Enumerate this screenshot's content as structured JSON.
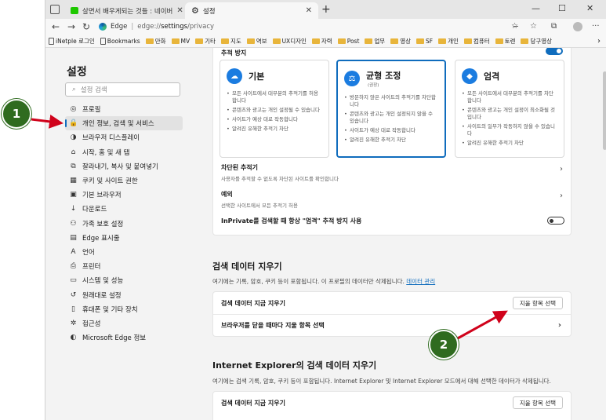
{
  "tabs": [
    {
      "title": "살면서 배우게되는 것들 : 네이버"
    },
    {
      "title": "설정"
    }
  ],
  "address": {
    "site": "Edge",
    "separator": "|",
    "scheme": "edge://",
    "host": "settings",
    "path": "/privacy"
  },
  "bookmarks": [
    "iNetple 로그인",
    "Bookmarks",
    "만화",
    "MV",
    "기타",
    "지도",
    "역보",
    "UX디자인",
    "자력",
    "Post",
    "업무",
    "영상",
    "SF",
    "개인",
    "컴퓨터",
    "토렌",
    "당구영상"
  ],
  "sidebar": {
    "title": "설정",
    "search_placeholder": "설정 검색",
    "items": [
      {
        "label": "프로필",
        "icon": "profile-icon",
        "glyph": "◎"
      },
      {
        "label": "개인 정보, 검색 및 서비스",
        "icon": "lock-icon",
        "glyph": "🔒",
        "active": true
      },
      {
        "label": "브라우저 디스플레이",
        "icon": "appearance-icon",
        "glyph": "◑"
      },
      {
        "label": "시작, 홈 및 새 탭",
        "icon": "home-icon",
        "glyph": "⌂"
      },
      {
        "label": "잘라내기, 복사 및 붙여넣기",
        "icon": "share-icon",
        "glyph": "⧉"
      },
      {
        "label": "쿠키 및 사이트 권한",
        "icon": "cookie-icon",
        "glyph": "▦"
      },
      {
        "label": "기본 브라우저",
        "icon": "browser-icon",
        "glyph": "▣"
      },
      {
        "label": "다운로드",
        "icon": "download-icon",
        "glyph": "↓"
      },
      {
        "label": "가족 보호 설정",
        "icon": "family-icon",
        "glyph": "⚇"
      },
      {
        "label": "Edge 표시줄",
        "icon": "bar-icon",
        "glyph": "▤"
      },
      {
        "label": "언어",
        "icon": "language-icon",
        "glyph": "A"
      },
      {
        "label": "프린터",
        "icon": "printer-icon",
        "glyph": "⎙"
      },
      {
        "label": "시스템 및 성능",
        "icon": "system-icon",
        "glyph": "▭"
      },
      {
        "label": "원래대로 설정",
        "icon": "reset-icon",
        "glyph": "↺"
      },
      {
        "label": "휴대폰 및 기타 장치",
        "icon": "phone-icon",
        "glyph": "▯"
      },
      {
        "label": "접근성",
        "icon": "accessibility-icon",
        "glyph": "✲"
      },
      {
        "label": "Microsoft Edge 정보",
        "icon": "edge-icon",
        "glyph": "◐"
      }
    ]
  },
  "tracking": {
    "title": "추적 방지",
    "options": [
      {
        "name": "기본",
        "recommended": "",
        "bullets": [
          "모든 사이트에서 대부분의 추적기를 허용합니다",
          "콘텐츠와 광고는 개인 설정될 수 있습니다",
          "사이트가 예상 대로 작동합니다",
          "알려진 유해한 추적기 차단"
        ]
      },
      {
        "name": "균형 조정",
        "recommended": "(권장)",
        "bullets": [
          "방문하지 않은 사이트의 추적기를 차단합니다",
          "콘텐츠와 광고는 개인 설정되지 않을 수 있습니다",
          "사이트가 예상 대로 작동합니다",
          "알려진 유해한 추적기 차단"
        ]
      },
      {
        "name": "엄격",
        "recommended": "",
        "bullets": [
          "모든 사이트에서 대부분의 추적기를 차단합니다",
          "콘텐츠와 광고는 개인 설정이 최소화될 것입니다",
          "사이트의 일부가 작동하지 않을 수 있습니다",
          "알려진 유해한 추적기 차단"
        ]
      }
    ],
    "blocked_title": "차단된 추적기",
    "blocked_sub": "사용자를 추적할 수 없도록 차단된 사이트를 확인합니다",
    "exceptions_title": "예외",
    "exceptions_sub": "선택한 사이트에서 모든 추적기 허용",
    "inprivate": "InPrivate를 검색할 때 항상 \"엄격\" 추적 방지 사용"
  },
  "clear_data": {
    "title": "검색 데이터 지우기",
    "desc": "여기에는 기록, 암호, 쿠키 등이 포함됩니다. 이 프로필의 데이터만 삭제됩니다.",
    "link": "데이터 관리",
    "now_label": "검색 데이터 지금 지우기",
    "button": "지울 항목 선택",
    "on_close": "브라우저를 닫을 때마다 지울 항목 선택"
  },
  "ie_clear": {
    "title": "Internet Explorer의 검색 데이터 지우기",
    "desc": "여기에는 검색 기록, 암호, 쿠키 등이 포함됩니다. Internet Explorer 및 Internet Explorer 모드에서 대해 선택한 데이터가 삭제됩니다.",
    "now_label": "검색 데이터 지금 지우기",
    "button": "지울 항목 선택"
  },
  "annotations": {
    "badge1": "1",
    "badge2": "2"
  },
  "colors": {
    "accent": "#0f6cbd",
    "badge": "#2f6b1f",
    "arrow": "#d0021b"
  }
}
